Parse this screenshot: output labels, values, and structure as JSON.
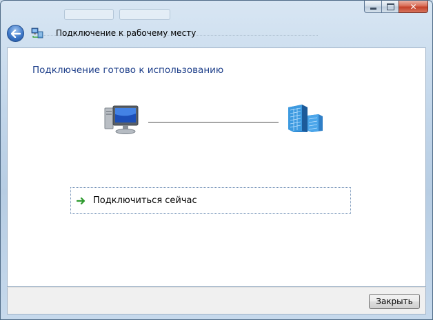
{
  "window": {
    "title": "Подключение к рабочему месту"
  },
  "caption_buttons": {
    "minimize_icon": "minimize-icon",
    "maximize_icon": "maximize-icon",
    "close_glyph": "✕"
  },
  "nav": {
    "back_icon": "back-arrow-icon"
  },
  "main": {
    "heading": "Подключение готово к использованию",
    "connect_option": {
      "label": "Подключиться сейчас",
      "icon": "green-arrow-icon"
    }
  },
  "footer": {
    "close_label": "Закрыть"
  },
  "colors": {
    "heading": "#1e3f8a",
    "arrow_green": "#2e9a2e",
    "close_red": "#c4412a"
  }
}
